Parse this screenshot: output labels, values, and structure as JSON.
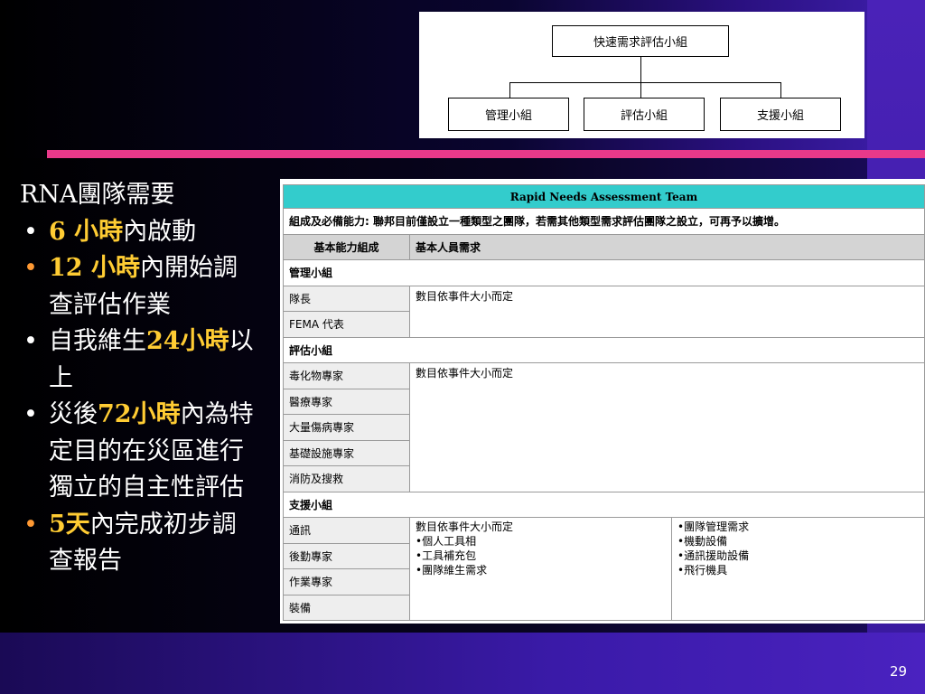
{
  "org_chart": {
    "root": "快速需求評估小組",
    "children": [
      "管理小組",
      "評估小組",
      "支援小組"
    ]
  },
  "left": {
    "title": "RNA團隊需要",
    "bullet": "•",
    "items": [
      {
        "hl": "6 小時",
        "rest": "內啟動"
      },
      {
        "hl": "12 小時",
        "rest": "內開始調查評估作業"
      },
      {
        "pre": "自我維生",
        "hl": "24小時",
        "rest": "以上"
      },
      {
        "pre": "災後",
        "hl": "72小時",
        "rest": "內為特定目的在災區進行獨立的自主性評估"
      },
      {
        "hl": "5天",
        "rest": "內完成初步調查報告"
      }
    ]
  },
  "table": {
    "title": "Rapid Needs Assessment Team",
    "note": "組成及必備能力: 聯邦目前僅設立一種類型之團隊，若需其他類型需求評估團隊之設立，可再予以擴增。",
    "col1": "基本能力組成",
    "col2": "基本人員需求",
    "groups": [
      {
        "name": "管理小組",
        "rows": [
          "隊長",
          "FEMA 代表"
        ],
        "need": [
          "數目依事件大小而定"
        ],
        "extra": []
      },
      {
        "name": "評估小組",
        "rows": [
          "毒化物專家",
          "醫療專家",
          "大量傷病專家",
          "基礎設施專家",
          "消防及搜救"
        ],
        "need": [
          "數目依事件大小而定"
        ],
        "extra": []
      },
      {
        "name": "支援小組",
        "rows": [
          "通訊",
          "後勤專家",
          "作業專家",
          "裝備"
        ],
        "need": [
          "數目依事件大小而定",
          "•個人工具相",
          "•工具補充包",
          "•團隊維生需求"
        ],
        "extra": [
          "•團隊管理需求",
          "•機動設備",
          "•通訊援助設備",
          "•飛行機具"
        ]
      }
    ]
  },
  "page_number": "29",
  "colors": {
    "accent_pink": "#e8398a",
    "highlight": "#ffcc33",
    "table_header": "#33cccc"
  }
}
